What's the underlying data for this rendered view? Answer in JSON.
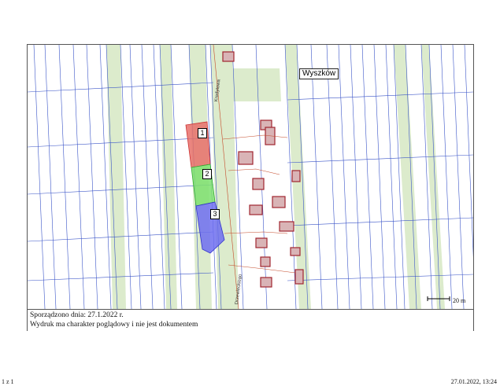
{
  "map": {
    "town_label": "Wyszków",
    "street_label_top": "Kredytowa",
    "street_label_bottom": "Drzewieckiego",
    "plots": [
      {
        "id": "1",
        "color": "#e8706a"
      },
      {
        "id": "2",
        "color": "#7ee06e"
      },
      {
        "id": "3",
        "color": "#6f6ff0"
      }
    ],
    "scale_label": "20 m",
    "colors": {
      "parcel_lines": "#3b55c8",
      "roads": "#c8dfb0",
      "buildings": "#b4333a",
      "utility": "#c44a2a"
    }
  },
  "legend": {
    "line1": "Sporządzono dnia: 27.1.2022 r.",
    "line2": "Wydruk ma charakter poglądowy i nie jest dokumentem"
  },
  "footer": {
    "page": "1 z 1",
    "datetime": "27.01.2022, 13:24"
  }
}
